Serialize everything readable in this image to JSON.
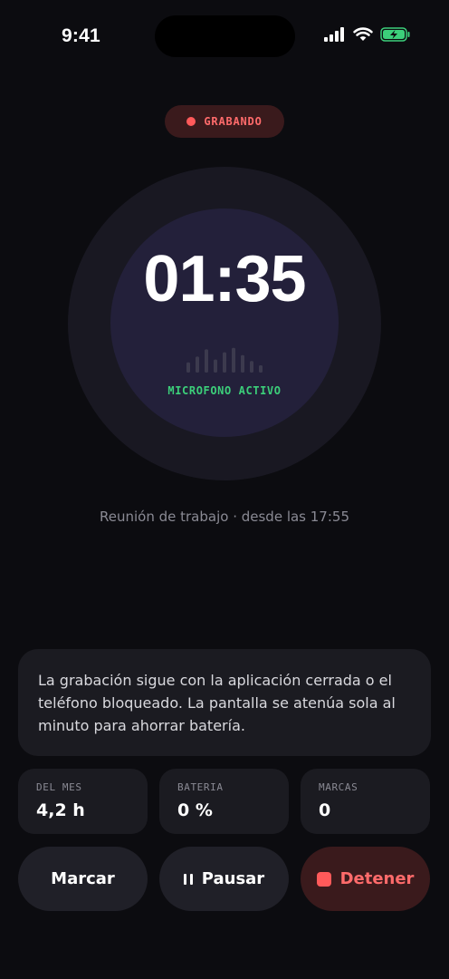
{
  "status_bar": {
    "time": "9:41",
    "icons": [
      "cellular-signal-icon",
      "wifi-icon",
      "battery-charging-icon"
    ]
  },
  "recording": {
    "label": "GRABANDO",
    "color": "#ff5a5a"
  },
  "timer": {
    "elapsed": "01:35",
    "mic_status": "MICROFONO ACTIVO",
    "mic_color": "#3ccf7a",
    "level_bars": [
      0.35,
      0.55,
      0.8,
      0.45,
      0.7,
      0.85,
      0.6,
      0.4,
      0.25
    ]
  },
  "session": {
    "caption": "Reunión de trabajo · desde las 17:55"
  },
  "info": {
    "text": "La grabación sigue con la aplicación cerrada o el teléfono bloqueado. La pantalla se atenúa sola al minuto para ahorrar batería."
  },
  "stats": [
    {
      "label": "DEL MES",
      "value": "4,2 h"
    },
    {
      "label": "BATERIA",
      "value": "0 %"
    },
    {
      "label": "MARCAS",
      "value": "0"
    }
  ],
  "actions": {
    "mark": "Marcar",
    "pause": "Pausar",
    "stop": "Detener"
  }
}
